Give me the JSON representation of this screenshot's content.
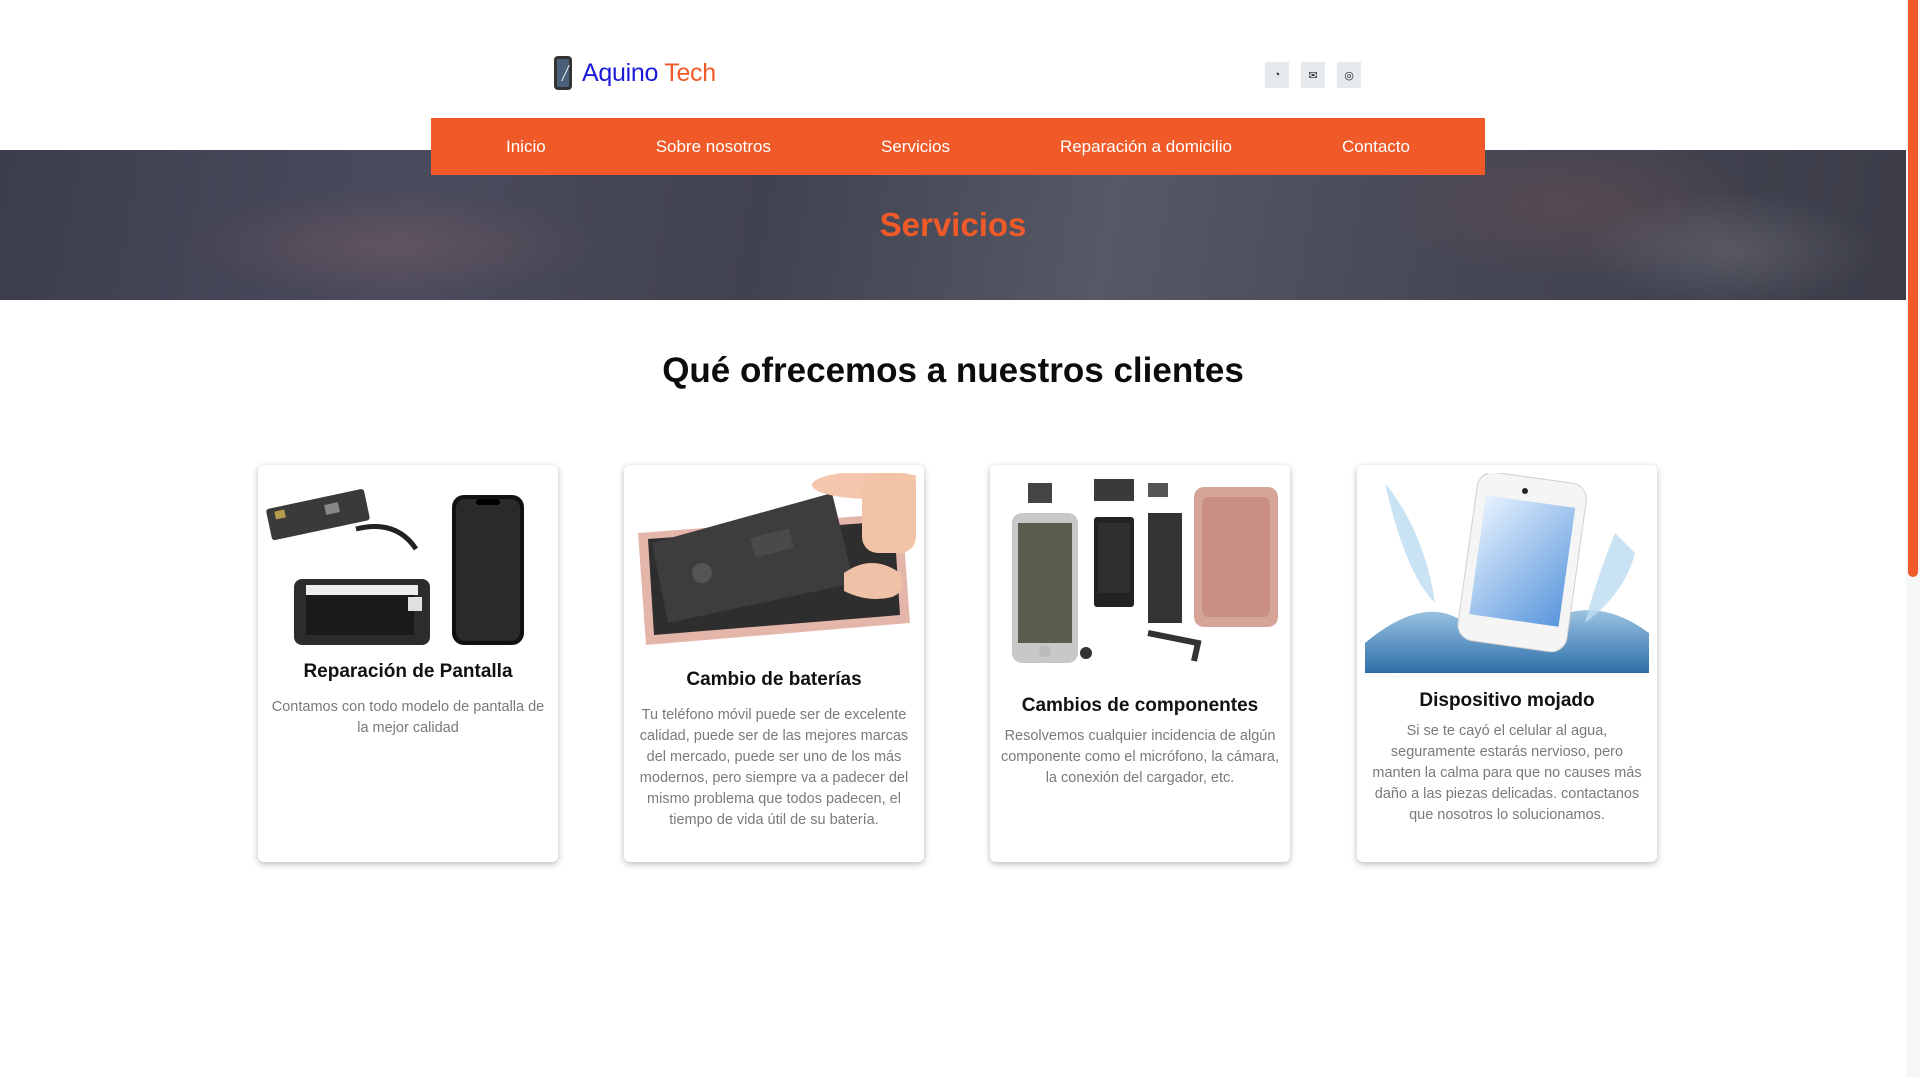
{
  "brand": {
    "name_part1": "Aquino",
    "name_part2": "Tech"
  },
  "social": [
    {
      "icon": "whatsapp-icon",
      "glyph": "◔"
    },
    {
      "icon": "envelope-icon",
      "glyph": "✉"
    },
    {
      "icon": "instagram-icon",
      "glyph": "◎"
    }
  ],
  "nav": {
    "items": [
      "Inicio",
      "Sobre nosotros",
      "Servicios",
      "Reparación a domicilio",
      "Contacto"
    ]
  },
  "hero": {
    "title": "Servicios"
  },
  "section": {
    "title": "Qué ofrecemos a nuestros clientes"
  },
  "cards": [
    {
      "title": "Reparación de Pantalla",
      "description": "Contamos con todo modelo de pantalla de la mejor calidad"
    },
    {
      "title": "Cambio de baterías",
      "description": "Tu teléfono móvil puede ser de excelente calidad, puede ser de las mejores marcas del mercado, puede ser uno de los más modernos, pero siempre va a padecer del mismo problema que todos padecen, el tiempo de vida útil de su batería."
    },
    {
      "title": "Cambios de componentes",
      "description": "Resolvemos cualquier incidencia de algún componente como el micrófono, la cámara, la conexión del cargador, etc."
    },
    {
      "title": "Dispositivo mojado",
      "description": "Si se te cayó el celular al agua, seguramente estarás nervioso, pero manten la calma para que no causes más daño a las piezas delicadas. contactanos que nosotros lo solucionamos."
    }
  ],
  "colors": {
    "accent": "#f05a28",
    "brand_blue": "#1b1bd8",
    "hero_bg": "#454654"
  }
}
